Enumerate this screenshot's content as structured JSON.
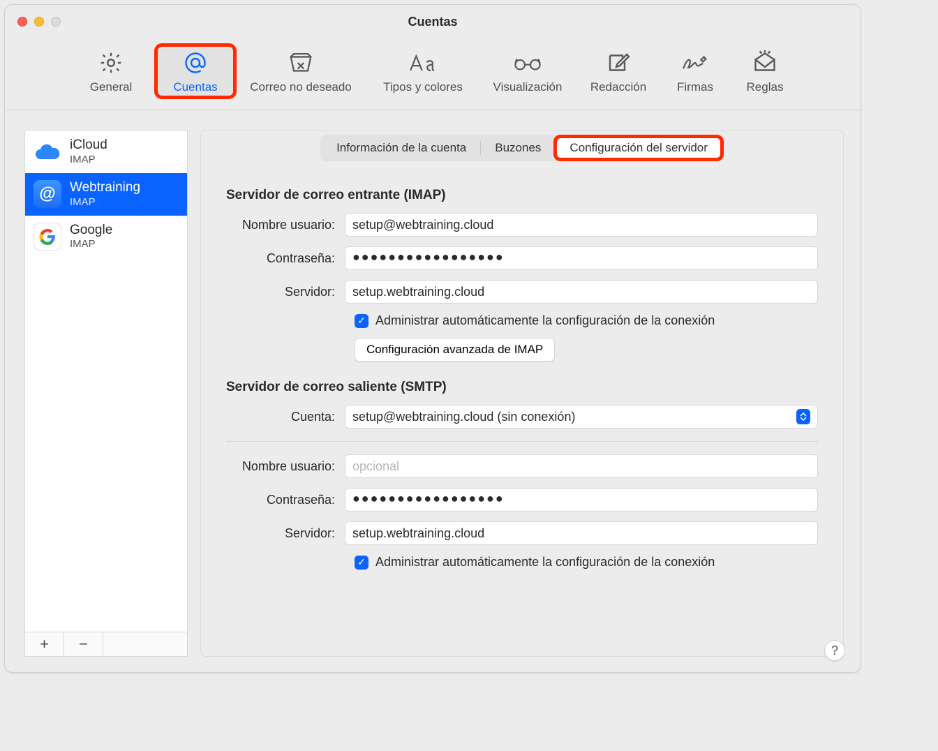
{
  "window_title": "Cuentas",
  "toolbar": [
    {
      "id": "general",
      "label": "General"
    },
    {
      "id": "accounts",
      "label": "Cuentas"
    },
    {
      "id": "junk",
      "label": "Correo no deseado"
    },
    {
      "id": "fonts",
      "label": "Tipos y colores"
    },
    {
      "id": "viewing",
      "label": "Visualización"
    },
    {
      "id": "compose",
      "label": "Redacción"
    },
    {
      "id": "signatures",
      "label": "Firmas"
    },
    {
      "id": "rules",
      "label": "Reglas"
    }
  ],
  "accounts": [
    {
      "name": "iCloud",
      "proto": "IMAP"
    },
    {
      "name": "Webtraining",
      "proto": "IMAP"
    },
    {
      "name": "Google",
      "proto": "IMAP"
    }
  ],
  "sidebar_buttons": {
    "add": "+",
    "remove": "−"
  },
  "tabs": {
    "info": "Información de la cuenta",
    "mailboxes": "Buzones",
    "server": "Configuración del servidor"
  },
  "incoming": {
    "title": "Servidor de correo entrante (IMAP)",
    "username_label": "Nombre usuario:",
    "username": "setup@webtraining.cloud",
    "password_label": "Contraseña:",
    "password": "●●●●●●●●●●●●●●●●●",
    "host_label": "Servidor:",
    "host": "setup.webtraining.cloud",
    "auto_label": "Administrar automáticamente la configuración de la conexión",
    "advanced_btn": "Configuración avanzada de IMAP"
  },
  "outgoing": {
    "title": "Servidor de correo saliente (SMTP)",
    "account_label": "Cuenta:",
    "account_selected": "setup@webtraining.cloud (sin conexión)",
    "username_label": "Nombre usuario:",
    "username_placeholder": "opcional",
    "password_label": "Contraseña:",
    "password": "●●●●●●●●●●●●●●●●●",
    "host_label": "Servidor:",
    "host": "setup.webtraining.cloud",
    "auto_label": "Administrar automáticamente la configuración de la conexión"
  },
  "help": "?"
}
